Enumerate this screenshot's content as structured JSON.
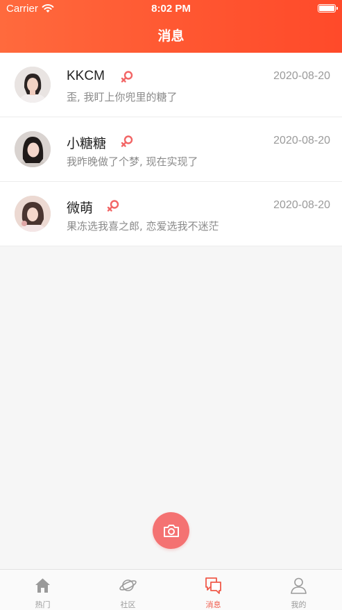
{
  "status_bar": {
    "carrier": "Carrier",
    "time": "8:02 PM"
  },
  "header": {
    "title": "消息"
  },
  "messages": [
    {
      "name": "KKCM",
      "date": "2020-08-20",
      "preview": "歪, 我盯上你兜里的糖了"
    },
    {
      "name": "小糖糖",
      "date": "2020-08-20",
      "preview": "我昨晚做了个梦, 现在实现了"
    },
    {
      "name": "微萌",
      "date": "2020-08-20",
      "preview": "果冻选我喜之郎, 恋爱选我不迷茫"
    }
  ],
  "camera_button": {
    "icon": "camera-icon"
  },
  "tabs": [
    {
      "label": "热门",
      "icon": "home-icon"
    },
    {
      "label": "社区",
      "icon": "planet-icon"
    },
    {
      "label": "消息",
      "icon": "chat-icon",
      "active": true
    },
    {
      "label": "我的",
      "icon": "user-icon"
    }
  ],
  "colors": {
    "header_start": "#ff6a3d",
    "header_end": "#ff4a2a",
    "accent": "#f47272",
    "active_tab": "#f05a4a",
    "gender_female": "#f26565"
  }
}
